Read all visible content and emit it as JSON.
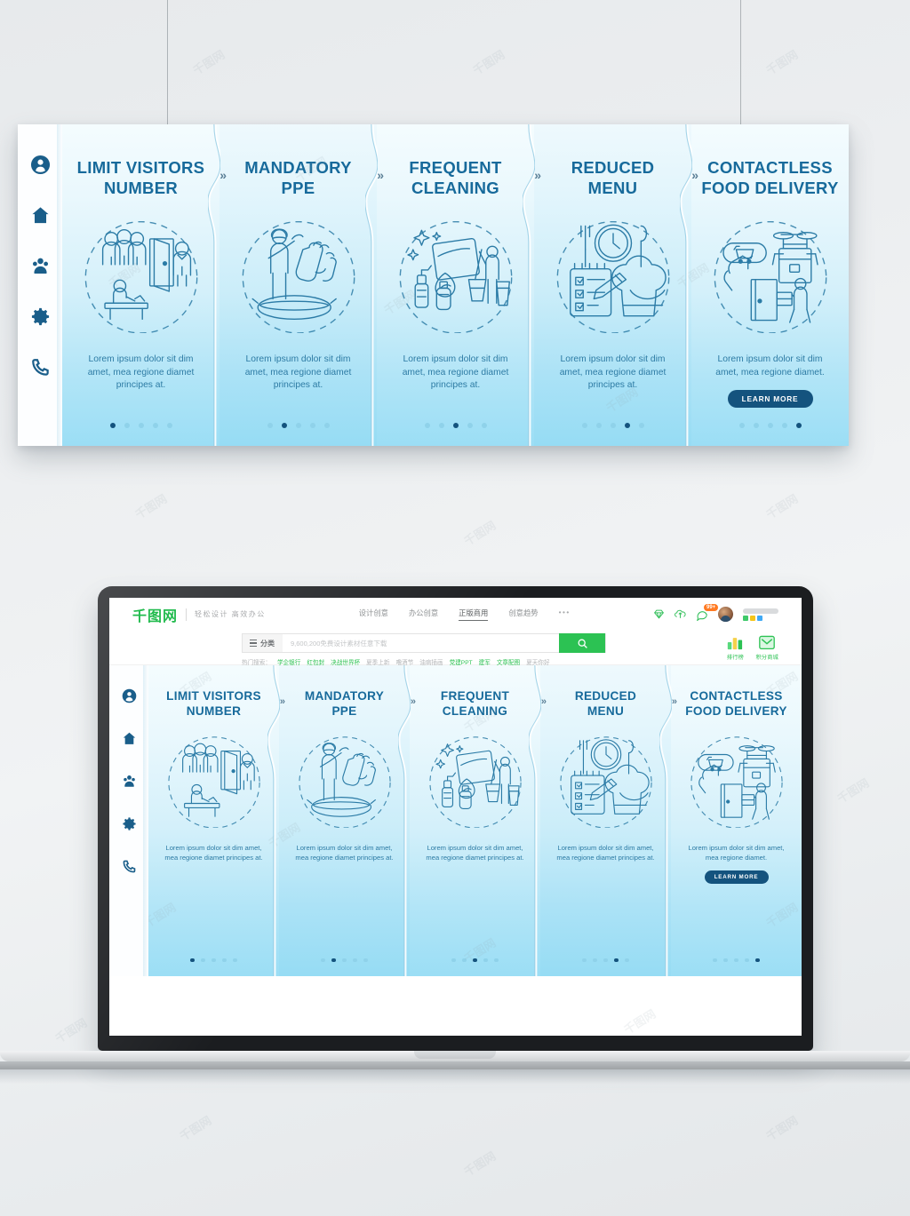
{
  "page": {
    "bg_color": "#edeff1",
    "accent_dark": "#14537e",
    "accent_title": "#176a9b",
    "card_gradient_top": "#f4fcfe",
    "card_gradient_bottom": "#9bdef5",
    "brand_green": "#2cc253"
  },
  "sidebar": {
    "items": [
      {
        "icon": "user-icon",
        "name": "sidebar-item-profile"
      },
      {
        "icon": "home-icon",
        "name": "sidebar-item-home"
      },
      {
        "icon": "group-icon",
        "name": "sidebar-item-people"
      },
      {
        "icon": "gear-icon",
        "name": "sidebar-item-settings"
      },
      {
        "icon": "phone-icon",
        "name": "sidebar-item-contact"
      }
    ]
  },
  "onboarding": {
    "chevron": "»",
    "cta_label": "LEARN MORE",
    "dot_count": 5,
    "cards": [
      {
        "title": "LIMIT VISITORS NUMBER",
        "title_line1": "LIMIT VISITORS",
        "title_line2": "NUMBER",
        "body": "Lorem ipsum dolor sit dim amet, mea regione diamet principes at.",
        "illustration": "visitors-limit-illustration",
        "active_dot": 0,
        "has_cta": false
      },
      {
        "title": "MANDATORY PPE",
        "title_line1": "MANDATORY",
        "title_line2": "PPE",
        "body": "Lorem ipsum dolor sit dim amet, mea regione diamet principes at.",
        "illustration": "ppe-mask-gloves-illustration",
        "active_dot": 1,
        "has_cta": false
      },
      {
        "title": "FREQUENT CLEANING",
        "title_line1": "FREQUENT",
        "title_line2": "CLEANING",
        "body": "Lorem ipsum dolor sit dim amet, mea regione diamet principes at.",
        "illustration": "cleaning-spray-mop-illustration",
        "active_dot": 2,
        "has_cta": false
      },
      {
        "title": "REDUCED MENU",
        "title_line1": "REDUCED",
        "title_line2": "MENU",
        "body": "Lorem ipsum dolor sit dim amet, mea regione diamet principes at.",
        "illustration": "menu-clock-chefhat-illustration",
        "active_dot": 3,
        "has_cta": false
      },
      {
        "title": "CONTACTLESS FOOD DELIVERY",
        "title_line1": "CONTACTLESS",
        "title_line2": "FOOD DELIVERY",
        "body": "Lorem ipsum dolor sit dim amet, mea regione diamet.",
        "illustration": "drone-delivery-door-illustration",
        "active_dot": 4,
        "has_cta": true
      }
    ]
  },
  "site_header": {
    "logo_text": "千图网",
    "tagline": "轻松设计  高效办公",
    "nav": [
      {
        "label": "设计创意",
        "selected": false
      },
      {
        "label": "办公创意",
        "selected": false
      },
      {
        "label": "正版商用",
        "selected": true
      },
      {
        "label": "创意趋势",
        "selected": false
      }
    ],
    "nav_more": "•••",
    "icons": [
      {
        "name": "vip-diamond-icon"
      },
      {
        "name": "upload-cloud-icon"
      },
      {
        "name": "message-icon",
        "badge": "99+"
      }
    ],
    "user": {
      "name": "avatar"
    }
  },
  "search": {
    "category_label": "分类",
    "placeholder": "9,600,200免费设计素材任意下载",
    "value": "",
    "button_icon": "search-icon",
    "hot_label": "热门搜索：",
    "hot_tags": [
      {
        "label": "学企银行",
        "highlight": true
      },
      {
        "label": "红包封",
        "highlight": true
      },
      {
        "label": "决战世界杯",
        "highlight": true
      },
      {
        "label": "夏季上新",
        "highlight": false
      },
      {
        "label": "噜酒节",
        "highlight": false
      },
      {
        "label": "油病插画",
        "highlight": false
      },
      {
        "label": "党建PPT",
        "highlight": true
      },
      {
        "label": "建军",
        "highlight": true
      },
      {
        "label": "文章配图",
        "highlight": true
      },
      {
        "label": "夏天你好",
        "highlight": false
      }
    ],
    "corner_buttons": [
      {
        "label": "排行榜",
        "icon": "ranking-icon"
      },
      {
        "label": "积分商城",
        "icon": "mall-icon"
      }
    ]
  },
  "watermark": {
    "text": "千图网"
  }
}
